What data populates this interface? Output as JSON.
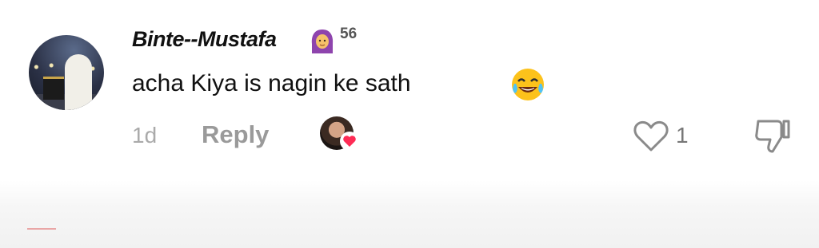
{
  "comment": {
    "author": "Binte--Mustafa",
    "author_badge_icon": "woman-with-headscarf-emoji",
    "author_score": "56",
    "text": "acha Kiya is nagin ke sath",
    "text_emoji": "face-with-tears-of-joy-emoji",
    "timestamp": "1d",
    "reply_label": "Reply",
    "likes": "1",
    "creator_liked": true,
    "colors": {
      "heart_badge": "#fe2c55",
      "muted_text": "#aaaaaa",
      "author_text": "#111111"
    }
  }
}
